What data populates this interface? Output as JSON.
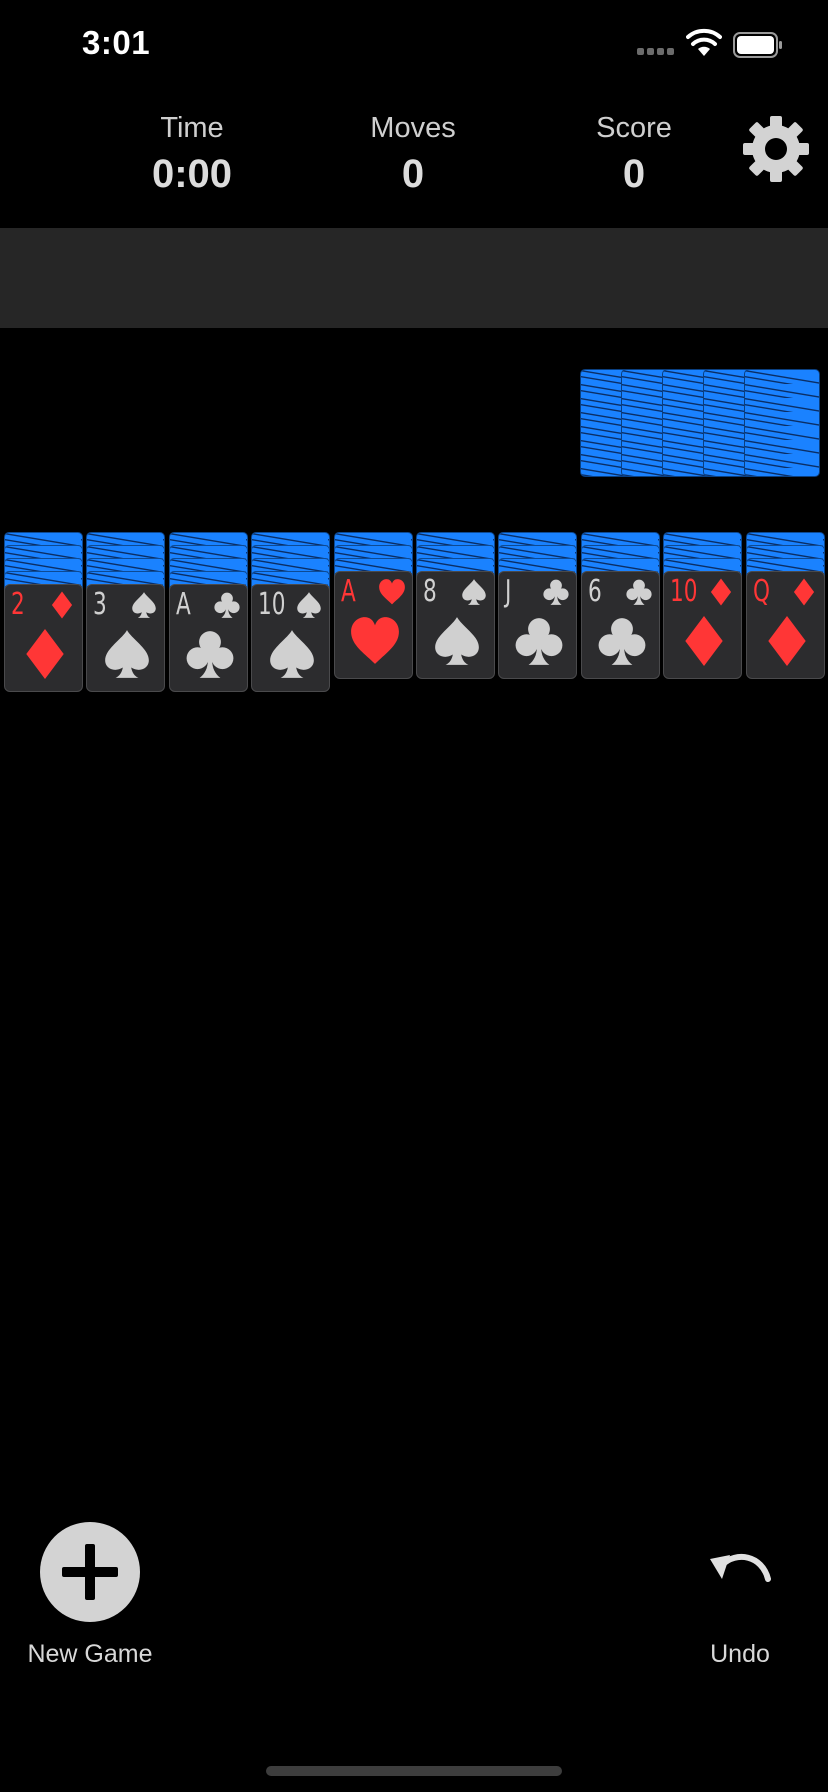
{
  "status_bar": {
    "time": "3:01"
  },
  "stats": {
    "time_label": "Time",
    "time_value": "0:00",
    "moves_label": "Moves",
    "moves_value": "0",
    "score_label": "Score",
    "score_value": "0"
  },
  "colors": {
    "card_back": "#1a82ff",
    "card_face": "#2c2c2e",
    "red_suit": "#ff3636",
    "black_suit": "#d0d0d0",
    "banner": "#262626"
  },
  "stock": {
    "piles": 5
  },
  "tableau": [
    {
      "face_down": 4,
      "rank": "2",
      "suit": "diamonds",
      "color": "red"
    },
    {
      "face_down": 4,
      "rank": "3",
      "suit": "spades",
      "color": "black"
    },
    {
      "face_down": 4,
      "rank": "A",
      "suit": "clubs",
      "color": "black"
    },
    {
      "face_down": 4,
      "rank": "10",
      "suit": "spades",
      "color": "black"
    },
    {
      "face_down": 3,
      "rank": "A",
      "suit": "hearts",
      "color": "red"
    },
    {
      "face_down": 3,
      "rank": "8",
      "suit": "spades",
      "color": "black"
    },
    {
      "face_down": 3,
      "rank": "J",
      "suit": "clubs",
      "color": "black"
    },
    {
      "face_down": 3,
      "rank": "6",
      "suit": "clubs",
      "color": "black"
    },
    {
      "face_down": 3,
      "rank": "10",
      "suit": "diamonds",
      "color": "red"
    },
    {
      "face_down": 3,
      "rank": "Q",
      "suit": "diamonds",
      "color": "red"
    }
  ],
  "toolbar": {
    "new_game_label": "New Game",
    "new_game_icon": "plus-icon",
    "undo_label": "Undo",
    "undo_icon": "undo-arrow-icon",
    "settings_icon": "gear-icon"
  }
}
